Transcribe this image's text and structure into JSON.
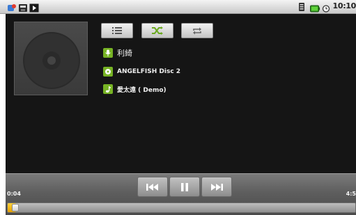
{
  "status_bar": {
    "time": "10:10",
    "icons": [
      "notification-icon",
      "sd-card-icon",
      "play-notification-icon",
      "signal-icon",
      "battery-icon",
      "alarm-clock-icon"
    ]
  },
  "now_playing": {
    "artist": "利綺",
    "album": "ANGELFISH Disc 2",
    "track": "愛太遠 ( Demo)"
  },
  "buttons": {
    "playlist": "playlist-icon",
    "shuffle": "shuffle-icon",
    "repeat": "repeat-icon"
  },
  "playback": {
    "elapsed": "0:04",
    "total": "4:5",
    "progress_fraction": 0.015
  },
  "colors": {
    "accent_green": "#77b324",
    "seek_orange": "#f2b400",
    "background": "#151515"
  }
}
